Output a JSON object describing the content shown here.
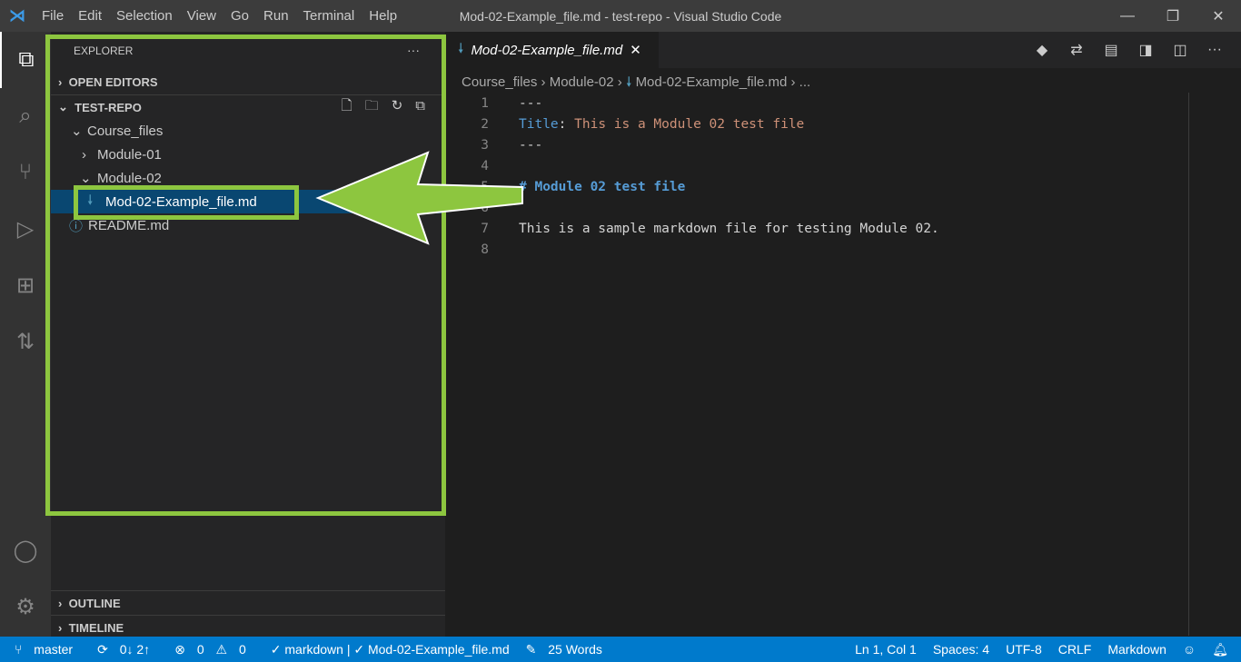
{
  "window": {
    "title": "Mod-02-Example_file.md - test-repo - Visual Studio Code",
    "menu": [
      "File",
      "Edit",
      "Selection",
      "View",
      "Go",
      "Run",
      "Terminal",
      "Help"
    ]
  },
  "sidebar": {
    "title": "EXPLORER",
    "more": "···",
    "open_editors": "OPEN EDITORS",
    "repo": "TEST-REPO",
    "tree": [
      {
        "label": "Course_files",
        "chev": "⌄"
      },
      {
        "label": "Module-01",
        "chev": "›"
      },
      {
        "label": "Module-02",
        "chev": "⌄"
      },
      {
        "label": "Mod-02-Example_file.md",
        "icon": "🠗"
      },
      {
        "label": "README.md",
        "icon": "ⓘ"
      }
    ],
    "outline": "OUTLINE",
    "timeline": "TIMELINE"
  },
  "editor": {
    "tab": "Mod-02-Example_file.md",
    "close": "✕",
    "breadcrumb": [
      "Course_files",
      "Module-02",
      "Mod-02-Example_file.md",
      "..."
    ],
    "lines": [
      {
        "n": "1",
        "t": "---"
      },
      {
        "n": "2",
        "k": "Title",
        "t": ": ",
        "v": "This is a Module 02 test file"
      },
      {
        "n": "3",
        "t": "---"
      },
      {
        "n": "4",
        "t": ""
      },
      {
        "n": "5",
        "h": "# Module 02 test file"
      },
      {
        "n": "6",
        "t": ""
      },
      {
        "n": "7",
        "t": "This is a sample markdown file for testing Module 02."
      },
      {
        "n": "8",
        "t": ""
      }
    ]
  },
  "status": {
    "branch": "master",
    "sync": "0↓ 2↑",
    "errors": "0",
    "warnings": "0",
    "lint": "✓ markdown | ✓ Mod-02-Example_file.md",
    "words": "25 Words",
    "position": "Ln 1, Col 1",
    "spaces": "Spaces: 4",
    "encoding": "UTF-8",
    "eol": "CRLF",
    "language": "Markdown"
  },
  "colors": {
    "accent": "#007acc",
    "highlight": "#8dc63f"
  }
}
